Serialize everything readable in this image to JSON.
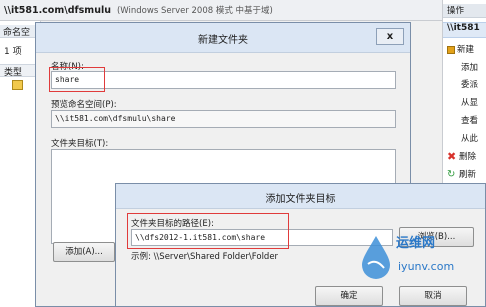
{
  "background": {
    "title_path": "\\\\it581.com\\dfsmulu",
    "title_sub": "(Windows Server 2008 模式 中基于域)",
    "namespace_header": "命名空",
    "item_count": "1 项",
    "col_type": "类型"
  },
  "actions_pane": {
    "header": "操作",
    "selected": "\\\\it581",
    "items": [
      {
        "label": "新建",
        "icon": "folder-new-icon",
        "color": "#e3a21a"
      },
      {
        "label": "添加",
        "icon": "",
        "color": ""
      },
      {
        "label": "委派",
        "icon": "",
        "color": ""
      },
      {
        "label": "从显",
        "icon": "",
        "color": ""
      },
      {
        "label": "查看",
        "icon": "",
        "color": ""
      },
      {
        "label": "从此",
        "icon": "",
        "color": ""
      },
      {
        "label": "删除",
        "icon": "delete-x-icon",
        "color": "#d8322c"
      },
      {
        "label": "刷新",
        "icon": "refresh-icon",
        "color": "#2f9a3c"
      }
    ]
  },
  "dialog_new_folder": {
    "title": "新建文件夹",
    "close": "x",
    "name_label": "名称(N):",
    "name_value": "share",
    "preview_label": "预览命名空间(P):",
    "preview_value": "\\\\it581.com\\dfsmulu\\share",
    "targets_label": "文件夹目标(T):",
    "add_button": "添加(A)..."
  },
  "dialog_add_target": {
    "title": "添加文件夹目标",
    "path_label": "文件夹目标的路径(E):",
    "path_value": "\\\\dfs2012-1.it581.com\\share",
    "browse_button": "浏览(B)...",
    "example": "示例: \\\\Server\\Shared Folder\\Folder",
    "ok_button": "确定",
    "cancel_button": "取消"
  },
  "watermark": {
    "line1": "运维网",
    "line2": "iyunv.com"
  },
  "colors": {
    "highlight_red": "#e03b3b",
    "titlebar": "#dbe6f4",
    "watermark_blue": "#2a78c8"
  }
}
